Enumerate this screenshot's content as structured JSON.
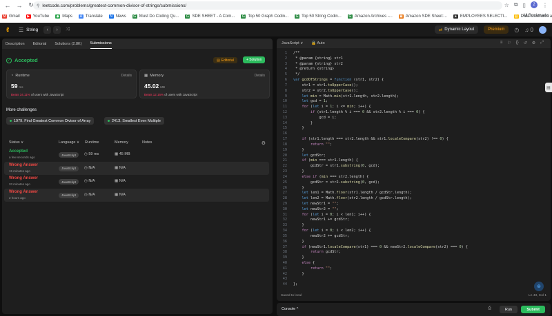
{
  "browser": {
    "url": "leetcode.com/problems/greatest-common-divisor-of-strings/submissions/",
    "bookmarks": [
      {
        "label": "Gmail",
        "color": "#ea4335",
        "glyph": "M"
      },
      {
        "label": "YouTube",
        "color": "#ff0000",
        "glyph": "▶"
      },
      {
        "label": "Maps",
        "color": "#34a853",
        "glyph": "◆"
      },
      {
        "label": "Translate",
        "color": "#4285f4",
        "glyph": "A"
      },
      {
        "label": "News",
        "color": "#1a73e8",
        "glyph": "N"
      },
      {
        "label": "Must Do Coding Qu...",
        "color": "#2f8d46",
        "glyph": "G"
      },
      {
        "label": "SDE SHEET - A Com...",
        "color": "#2f8d46",
        "glyph": "G"
      },
      {
        "label": "Top 50 Graph Codin...",
        "color": "#2f8d46",
        "glyph": "G"
      },
      {
        "label": "Top 50 String Codin...",
        "color": "#2f8d46",
        "glyph": "G"
      },
      {
        "label": "Amazon Archives -...",
        "color": "#2f8d46",
        "glyph": "G"
      },
      {
        "label": "Amazon SDE Sheet:...",
        "color": "#e8710a",
        "glyph": "▣"
      },
      {
        "label": "EMPLOYEES SELECTI...",
        "color": "#333333",
        "glyph": "●"
      },
      {
        "label": "Data structures and...",
        "color": "#fbbc04",
        "glyph": "▤"
      }
    ],
    "all_bookmarks": "All Bookmarks",
    "profile_initial": "2"
  },
  "nav": {
    "list_title": "String",
    "dynamic_layout": "Dynamic Layout",
    "premium": "Premium",
    "counter": "0"
  },
  "left": {
    "tabs": [
      "Description",
      "Editorial",
      "Solutions (2.8K)",
      "Submissions"
    ],
    "active_tab": 3,
    "status": "Accepted",
    "editorial_btn": "Editorial",
    "solution_btn": "+ Solution",
    "runtime": {
      "label": "Runtime",
      "details": "Details",
      "value": "59",
      "unit": "ms",
      "beats_pct": "Beats 34.11%",
      "beats_rest": " of users with JavaScript"
    },
    "memory": {
      "label": "Memory",
      "details": "Details",
      "value": "45.02",
      "unit": "MB",
      "beats_pct": "Beats 12.16%",
      "beats_rest": " of users with JavaScript"
    },
    "more_challenges": "More challenges",
    "challenges": [
      "1979. Find Greatest Common Divisor of Array",
      "2413. Smallest Even Multiple"
    ],
    "table_headers": {
      "status": "Status ∨",
      "language": "Language ∨",
      "runtime": "Runtime",
      "memory": "Memory",
      "notes": "Notes"
    },
    "submissions": [
      {
        "status": "Accepted",
        "time": "a few seconds ago",
        "lang": "JavaScript",
        "runtime": "59 ms",
        "memory": "45 MB",
        "ok": true
      },
      {
        "status": "Wrong Answer",
        "time": "15 minutes ago",
        "lang": "JavaScript",
        "runtime": "N/A",
        "memory": "N/A",
        "ok": false
      },
      {
        "status": "Wrong Answer",
        "time": "33 minutes ago",
        "lang": "JavaScript",
        "runtime": "N/A",
        "memory": "N/A",
        "ok": false
      },
      {
        "status": "Wrong Answer",
        "time": "2 hours ago",
        "lang": "JavaScript",
        "runtime": "N/A",
        "memory": "N/A",
        "ok": false
      }
    ]
  },
  "editor": {
    "language": "JavaScript",
    "mode": "Auto",
    "saved": "Saved to local",
    "position": "Ln 43, Col 1",
    "code": [
      "/**",
      " * @param {string} str1",
      " * @param {string} str2",
      " * @return {string}",
      " */",
      "var gcdOfStrings = function (str1, str2) {",
      "    str1 = str1.toUpperCase();",
      "    str2 = str2.toUpperCase();",
      "    let min = Math.min(str1.length, str2.length);",
      "    let gcd = 1;",
      "    for (let i = 1; i <= min; i++) {",
      "        if (str1.length % i === 0 && str2.length % i === 0) {",
      "            gcd = i;",
      "        }",
      "    }",
      "",
      "    if (str1.length === str2.length && str1.localeCompare(str2) !== 0) {",
      "        return \"\";",
      "    }",
      "    let gcdStr;",
      "    if (min === str1.length) {",
      "        gcdStr = str1.substring(0, gcd);",
      "    }",
      "    else if (min === str2.length) {",
      "        gcdStr = str2.substring(0, gcd);",
      "    }",
      "    let len1 = Math.floor(str1.length / gcdStr.length);",
      "    let len2 = Math.floor(str2.length / gcdStr.length);",
      "    let newStr1 = \"\";",
      "    let newStr2 = \"\";",
      "    for (let i = 0; i < len1; i++) {",
      "        newStr1 += gcdStr;",
      "    }",
      "    for (let i = 0; i < len2; i++) {",
      "        newStr2 += gcdStr;",
      "    }",
      "    if (newStr1.localeCompare(str1) === 0 && newStr2.localeCompare(str2) === 0) {",
      "        return gcdStr;",
      "    }",
      "    else {",
      "        return \"\";",
      "    }",
      "",
      "};"
    ]
  },
  "console": {
    "label": "Console ^",
    "run": "Run",
    "submit": "Submit"
  }
}
